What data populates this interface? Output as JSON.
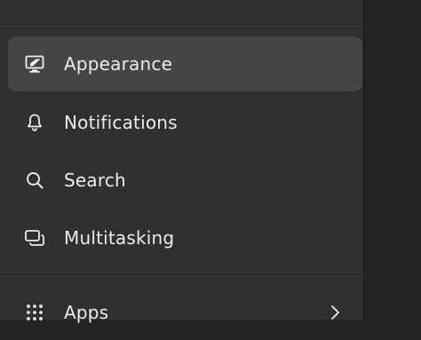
{
  "sidebar": {
    "items": [
      {
        "label": "Appearance",
        "icon": "appearance-icon",
        "selected": true
      },
      {
        "label": "Notifications",
        "icon": "bell-icon",
        "selected": false
      },
      {
        "label": "Search",
        "icon": "search-icon",
        "selected": false
      },
      {
        "label": "Multitasking",
        "icon": "multitasking-icon",
        "selected": false
      },
      {
        "label": "Apps",
        "icon": "apps-grid-icon",
        "selected": false,
        "has_submenu": true
      }
    ]
  },
  "colors": {
    "sidebar_bg": "#303030",
    "selected_bg": "#454545",
    "content_bg": "#242424",
    "text": "#ececec"
  }
}
